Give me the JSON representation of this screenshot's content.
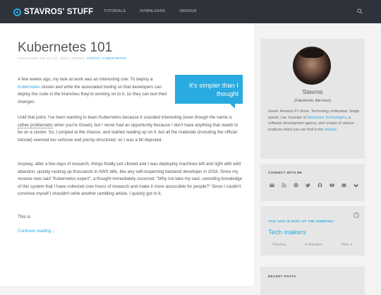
{
  "site": {
    "logo": "STAVROS' STUFF"
  },
  "nav": [
    "TUTORIALS",
    "DOWNLOADS",
    "VARIOUS"
  ],
  "post": {
    "title": "Kubernetes 101",
    "meta_prefix": "CONCEIVED ON JUL 27, 2018 / SERIES:",
    "meta_series": "HOWTO, KUBERNETES",
    "pullquote": "It's simpler than I thought",
    "p1_a": "A few weeks ago, my task at work was an interesting one: To deploy a ",
    "p1_link": "Kubernetes",
    "p1_b": " cluster and write the associated tooling so that developers can deploy the code in the branches they're working on to it, so they can test their changes.",
    "p2_a": "Until that point, I've been wanting to learn Kubernetes because it sounded interesting (even though the name is ",
    "p2_u": "rather problematic",
    "p2_b": " when you're Greek), but I never had an opportunity because I don't have anything that ",
    "p2_em": "needs",
    "p2_c": " to be on a cluster. So, I jumped at the chance, and started reading up on it, but all the materials (including the official tutorial) seemed too verbose and poorly-structured, so I was a bit dejected.",
    "p3": "Anyway, after a few days of research, things finally just clicked and I was deploying machines left and right with wild abandon, quickly racking up thousands in AWS bills, like any self-respecting backend developer in 2018. Since my resume now said \"Kubernetes expert\", a thought immediately occurred: \"Why not take my vast, unending knowledge of this system that I have collected over hours of research and make it more accessible for people?\" Since I couldn't convince myself I shouldn't write another rambling article, I quickly got to it.",
    "p4": "This is",
    "continue": "Continue reading..."
  },
  "sidebar": {
    "name": "Stavros",
    "tagline": "(Fake/ironic title here)",
    "bio_a": "Greek. Amateur F1 driver. Technology enthusiast. Single parent. Liar. Founder of ",
    "bio_link1": "Stochastic Technologies",
    "bio_b": ", a software development agency, and creator of various products which you can find in the ",
    "bio_link2": "résumé",
    "bio_c": ".",
    "connect_title": "CONNECT WITH ME",
    "social_icons": [
      "email-icon",
      "rss-icon",
      "mastodon-icon",
      "twitter-icon",
      "github-icon",
      "youtube-icon",
      "discord-icon",
      "gitlab-icon"
    ],
    "webring_title": "THIS SITE IS PART OF THE WEBRING:",
    "webring_help": "?",
    "webring_name": "Tech makers",
    "webring_prev": "← Previous",
    "webring_random": "⇄ Random",
    "webring_next": "Next ➔",
    "recent_title": "RECENT POSTS"
  },
  "colors": {
    "accent": "#29aae1",
    "topbar": "#2e323b"
  }
}
